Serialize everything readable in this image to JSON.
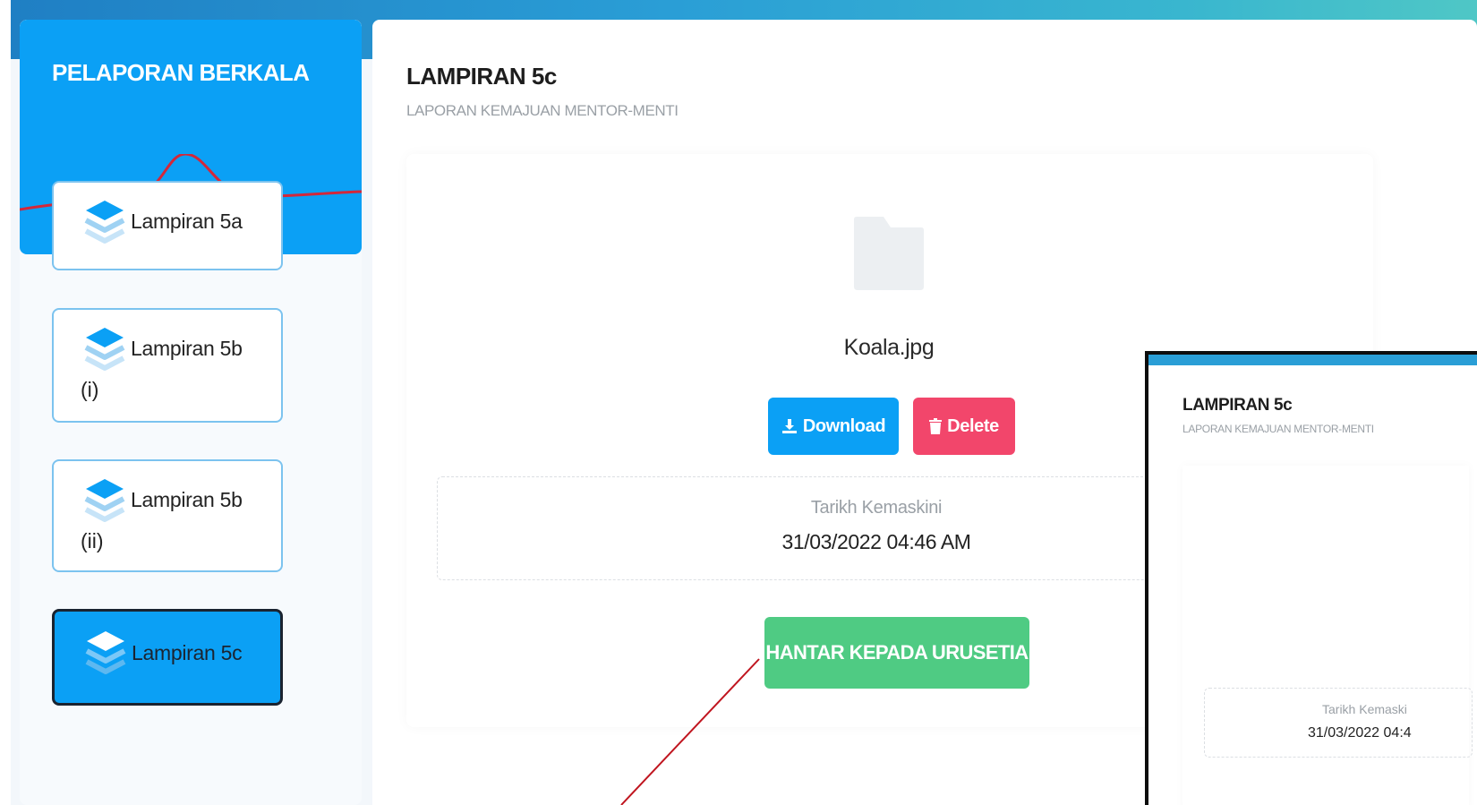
{
  "sidebar": {
    "title": "PELAPORAN BERKALA",
    "items": [
      {
        "label": "Lampiran 5a",
        "sub": ""
      },
      {
        "label": "Lampiran 5b",
        "sub": "(i)"
      },
      {
        "label": "Lampiran 5b",
        "sub": "(ii)"
      },
      {
        "label": "Lampiran 5c",
        "sub": ""
      }
    ],
    "active_index": 3
  },
  "main": {
    "title": "LAMPIRAN 5c",
    "subtitle": "LAPORAN KEMAJUAN MENTOR-MENTI",
    "file": {
      "name": "Koala.jpg",
      "icon": "folder-icon"
    },
    "download_label": "Download",
    "delete_label": "Delete",
    "date_label": "Tarikh Kemaskini",
    "date_value": "31/03/2022 04:46 AM",
    "submit_label": "HANTAR KEPADA URUSETIA"
  },
  "inset": {
    "title": "LAMPIRAN 5c",
    "subtitle": "LAPORAN KEMAJUAN MENTOR-MENTI",
    "date_label": "Tarikh Kemaski",
    "date_value": "31/03/2022 04:4"
  },
  "colors": {
    "primary": "#0ba0f5",
    "danger": "#f2466b",
    "success": "#4fcb83",
    "annotation_arrow": "#c0151f"
  }
}
